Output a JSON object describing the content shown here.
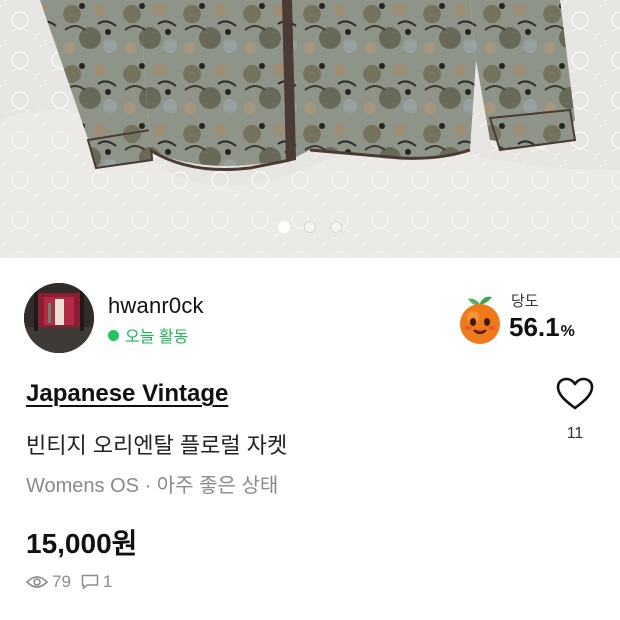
{
  "photo": {
    "image": "floral-vintage-jacket-on-lace",
    "pager": {
      "total": 3,
      "active_index": 0
    }
  },
  "seller": {
    "username": "hwanr0ck",
    "activity": "오늘 활동",
    "activity_color": "#22c55e",
    "sweetness_label": "당도",
    "sweetness_value": "56.1",
    "sweetness_unit": "%",
    "sweetness_icon": "peach-face-icon"
  },
  "product": {
    "brand": "Japanese Vintage",
    "title": "빈티지 오리엔탈 플로럴 자켓",
    "meta": "Womens OS · 아주 좋은 상태",
    "price": "15,000원",
    "like_count": "11",
    "views": "79",
    "chats": "1"
  },
  "colors": {
    "sweetness_orange": "#f07a1a",
    "activity_green": "#22c55e",
    "meta_gray": "#8a8a8a"
  }
}
